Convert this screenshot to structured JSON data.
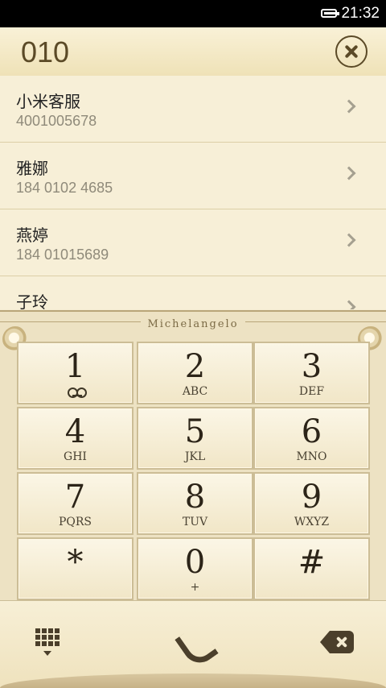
{
  "status": {
    "time": "21:32",
    "battery_icon": "battery-icon"
  },
  "header": {
    "dialed": "010",
    "clear_icon": "close-circle-icon"
  },
  "contacts": [
    {
      "name": "小米客服",
      "number": "4001005678"
    },
    {
      "name": "雅娜",
      "number": "184 0102 4685"
    },
    {
      "name": "燕婷",
      "number": "184 01015689"
    },
    {
      "name": "子玲",
      "number": ""
    }
  ],
  "keypad": {
    "brand": "Michelangelo",
    "keys": [
      {
        "digit": "1",
        "letters": ""
      },
      {
        "digit": "2",
        "letters": "ABC"
      },
      {
        "digit": "3",
        "letters": "DEF"
      },
      {
        "digit": "4",
        "letters": "GHI"
      },
      {
        "digit": "5",
        "letters": "JKL"
      },
      {
        "digit": "6",
        "letters": "MNO"
      },
      {
        "digit": "7",
        "letters": "PQRS"
      },
      {
        "digit": "8",
        "letters": "TUV"
      },
      {
        "digit": "9",
        "letters": "WXYZ"
      },
      {
        "digit": "*",
        "letters": ""
      },
      {
        "digit": "0",
        "letters": "+"
      },
      {
        "digit": "#",
        "letters": ""
      }
    ]
  },
  "toolbar": {
    "icons": [
      "dialpad-icon",
      "phone-icon",
      "backspace-icon"
    ]
  },
  "colors": {
    "accent": "#5b4a27",
    "background": "#f3ead0",
    "key": "#f7efd9"
  }
}
